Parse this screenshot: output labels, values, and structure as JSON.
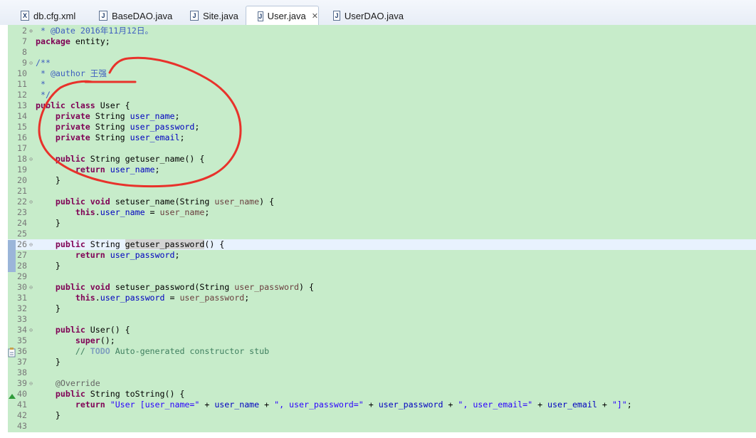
{
  "tabs": [
    {
      "label": "db.cfg.xml",
      "icon": "xml-file-icon",
      "glyph": "X",
      "active": false
    },
    {
      "label": "BaseDAO.java",
      "icon": "java-file-icon",
      "glyph": "J",
      "active": false
    },
    {
      "label": "Site.java",
      "icon": "java-file-icon",
      "glyph": "J",
      "active": false
    },
    {
      "label": "User.java",
      "icon": "java-file-icon",
      "glyph": "J",
      "active": true
    },
    {
      "label": "UserDAO.java",
      "icon": "java-file-icon",
      "glyph": "J",
      "active": false
    }
  ],
  "active_tab_close": "✕",
  "editor": {
    "lines": [
      {
        "num": "2",
        "fold": "⊕",
        "tokens": [
          {
            "t": " * ",
            "c": "jdoc"
          },
          {
            "t": "@Date",
            "c": "jdoc"
          },
          {
            "t": " 2016年11月12日。",
            "c": "jdoc"
          }
        ]
      },
      {
        "num": "7",
        "tokens": [
          {
            "t": "package",
            "c": "kw"
          },
          {
            "t": " entity;"
          }
        ]
      },
      {
        "num": "8",
        "tokens": []
      },
      {
        "num": "9",
        "fold": "⊖",
        "tokens": [
          {
            "t": "/**",
            "c": "jdoc"
          }
        ]
      },
      {
        "num": "10",
        "tokens": [
          {
            "t": " * ",
            "c": "jdoc"
          },
          {
            "t": "@author",
            "c": "jdoc"
          },
          {
            "t": " 王强",
            "c": "jdoc"
          }
        ]
      },
      {
        "num": "11",
        "tokens": [
          {
            "t": " *",
            "c": "jdoc"
          }
        ]
      },
      {
        "num": "12",
        "tokens": [
          {
            "t": " */",
            "c": "jdoc"
          }
        ]
      },
      {
        "num": "13",
        "tokens": [
          {
            "t": "public",
            "c": "kw"
          },
          {
            "t": " "
          },
          {
            "t": "class",
            "c": "kw"
          },
          {
            "t": " User {"
          }
        ]
      },
      {
        "num": "14",
        "tokens": [
          {
            "t": "    "
          },
          {
            "t": "private",
            "c": "kw"
          },
          {
            "t": " String "
          },
          {
            "t": "user_name",
            "c": "fld"
          },
          {
            "t": ";"
          }
        ]
      },
      {
        "num": "15",
        "tokens": [
          {
            "t": "    "
          },
          {
            "t": "private",
            "c": "kw"
          },
          {
            "t": " String "
          },
          {
            "t": "user_password",
            "c": "fld"
          },
          {
            "t": ";"
          }
        ]
      },
      {
        "num": "16",
        "tokens": [
          {
            "t": "    "
          },
          {
            "t": "private",
            "c": "kw"
          },
          {
            "t": " String "
          },
          {
            "t": "user_email",
            "c": "fld"
          },
          {
            "t": ";"
          }
        ]
      },
      {
        "num": "17",
        "tokens": []
      },
      {
        "num": "18",
        "fold": "⊖",
        "tokens": [
          {
            "t": "    "
          },
          {
            "t": "public",
            "c": "kw"
          },
          {
            "t": " String getuser_name() {"
          }
        ]
      },
      {
        "num": "19",
        "tokens": [
          {
            "t": "        "
          },
          {
            "t": "return",
            "c": "kw"
          },
          {
            "t": " "
          },
          {
            "t": "user_name",
            "c": "fld"
          },
          {
            "t": ";"
          }
        ]
      },
      {
        "num": "20",
        "tokens": [
          {
            "t": "    }"
          }
        ]
      },
      {
        "num": "21",
        "tokens": []
      },
      {
        "num": "22",
        "fold": "⊖",
        "tokens": [
          {
            "t": "    "
          },
          {
            "t": "public",
            "c": "kw"
          },
          {
            "t": " "
          },
          {
            "t": "void",
            "c": "kw"
          },
          {
            "t": " setuser_name(String "
          },
          {
            "t": "user_name",
            "c": "par"
          },
          {
            "t": ") {"
          }
        ]
      },
      {
        "num": "23",
        "tokens": [
          {
            "t": "        "
          },
          {
            "t": "this",
            "c": "kw"
          },
          {
            "t": "."
          },
          {
            "t": "user_name",
            "c": "fld"
          },
          {
            "t": " = "
          },
          {
            "t": "user_name",
            "c": "par"
          },
          {
            "t": ";"
          }
        ]
      },
      {
        "num": "24",
        "tokens": [
          {
            "t": "    }"
          }
        ]
      },
      {
        "num": "25",
        "tokens": []
      },
      {
        "num": "26",
        "fold": "⊖",
        "current": true,
        "tokens": [
          {
            "t": "    "
          },
          {
            "t": "public",
            "c": "kw"
          },
          {
            "t": " String "
          },
          {
            "t": "getuser_password",
            "c": "mark-hl"
          },
          {
            "t": "() {"
          }
        ]
      },
      {
        "num": "27",
        "tokens": [
          {
            "t": "        "
          },
          {
            "t": "return",
            "c": "kw"
          },
          {
            "t": " "
          },
          {
            "t": "user_password",
            "c": "fld"
          },
          {
            "t": ";"
          }
        ]
      },
      {
        "num": "28",
        "tokens": [
          {
            "t": "    }"
          }
        ]
      },
      {
        "num": "29",
        "tokens": []
      },
      {
        "num": "30",
        "fold": "⊖",
        "tokens": [
          {
            "t": "    "
          },
          {
            "t": "public",
            "c": "kw"
          },
          {
            "t": " "
          },
          {
            "t": "void",
            "c": "kw"
          },
          {
            "t": " setuser_password(String "
          },
          {
            "t": "user_password",
            "c": "par"
          },
          {
            "t": ") {"
          }
        ]
      },
      {
        "num": "31",
        "tokens": [
          {
            "t": "        "
          },
          {
            "t": "this",
            "c": "kw"
          },
          {
            "t": "."
          },
          {
            "t": "user_password",
            "c": "fld"
          },
          {
            "t": " = "
          },
          {
            "t": "user_password",
            "c": "par"
          },
          {
            "t": ";"
          }
        ]
      },
      {
        "num": "32",
        "tokens": [
          {
            "t": "    }"
          }
        ]
      },
      {
        "num": "33",
        "tokens": []
      },
      {
        "num": "34",
        "fold": "⊖",
        "tokens": [
          {
            "t": "    "
          },
          {
            "t": "public",
            "c": "kw"
          },
          {
            "t": " User() {"
          }
        ]
      },
      {
        "num": "35",
        "tokens": [
          {
            "t": "        "
          },
          {
            "t": "super",
            "c": "kw"
          },
          {
            "t": "();"
          }
        ]
      },
      {
        "num": "36",
        "tokens": [
          {
            "t": "        "
          },
          {
            "t": "// ",
            "c": "cmt"
          },
          {
            "t": "TODO",
            "c": "todo"
          },
          {
            "t": " Auto-generated constructor stub",
            "c": "cmt"
          }
        ]
      },
      {
        "num": "37",
        "tokens": [
          {
            "t": "    }"
          }
        ]
      },
      {
        "num": "38",
        "tokens": []
      },
      {
        "num": "39",
        "fold": "⊖",
        "tokens": [
          {
            "t": "    "
          },
          {
            "t": "@Override",
            "c": "ann"
          }
        ]
      },
      {
        "num": "40",
        "tokens": [
          {
            "t": "    "
          },
          {
            "t": "public",
            "c": "kw"
          },
          {
            "t": " String toString() {"
          }
        ]
      },
      {
        "num": "41",
        "tokens": [
          {
            "t": "        "
          },
          {
            "t": "return",
            "c": "kw"
          },
          {
            "t": " "
          },
          {
            "t": "\"User [user_name=\"",
            "c": "str"
          },
          {
            "t": " + "
          },
          {
            "t": "user_name",
            "c": "fld"
          },
          {
            "t": " + "
          },
          {
            "t": "\", user_password=\"",
            "c": "str"
          },
          {
            "t": " + "
          },
          {
            "t": "user_password",
            "c": "fld"
          },
          {
            "t": " + "
          },
          {
            "t": "\", user_email=\"",
            "c": "str"
          },
          {
            "t": " + "
          },
          {
            "t": "user_email",
            "c": "fld"
          },
          {
            "t": " + "
          },
          {
            "t": "\"]\"",
            "c": "str"
          },
          {
            "t": ";"
          }
        ]
      },
      {
        "num": "42",
        "tokens": [
          {
            "t": "    }"
          }
        ]
      },
      {
        "num": "43",
        "tokens": []
      }
    ]
  },
  "colors": {
    "editor_bg": "#c7ecca",
    "current_line": "#e8f2fe",
    "scribble": "#e8322b"
  }
}
